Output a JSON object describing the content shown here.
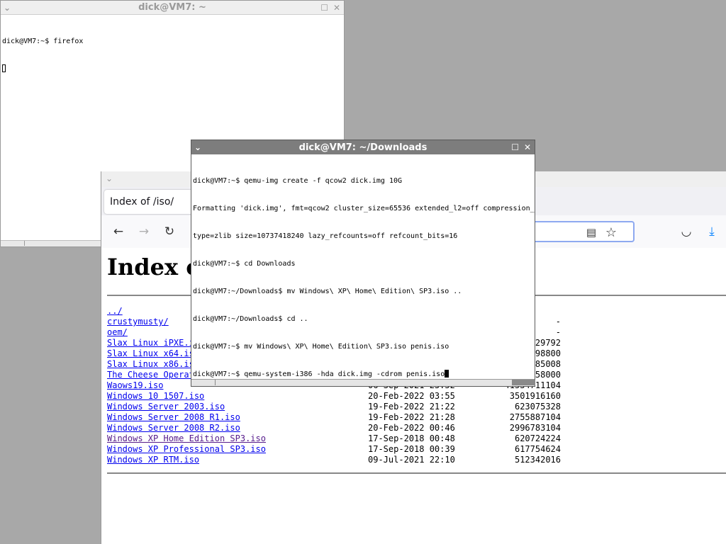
{
  "terminal1": {
    "title": "dick@VM7: ~",
    "lines": [
      "dick@VM7:~$ firefox"
    ]
  },
  "terminal2": {
    "title": "dick@VM7: ~/Downloads",
    "lines": [
      "dick@VM7:~$ qemu-img create -f qcow2 dick.img 10G",
      "Formatting 'dick.img', fmt=qcow2 cluster_size=65536 extended_l2=off compression_",
      "type=zlib size=10737418240 lazy_refcounts=off refcount_bits=16",
      "dick@VM7:~$ cd Downloads",
      "dick@VM7:~/Downloads$ mv Windows\\ XP\\ Home\\ Edition\\ SP3.iso ..",
      "dick@VM7:~/Downloads$ cd ..",
      "dick@VM7:~$ mv Windows\\ XP\\ Home\\ Edition\\ SP3.iso penis.iso",
      "dick@VM7:~$ qemu-system-i386 -hda dick.img -cdrom penis.iso"
    ]
  },
  "firefox": {
    "tab_title": "Index of /iso/",
    "heading": "Index of /iso/",
    "entries": [
      {
        "name": "../",
        "date": "",
        "size": "",
        "visited": false
      },
      {
        "name": "crustymusty/",
        "date": "",
        "size": "-",
        "visited": false
      },
      {
        "name": "oem/",
        "date": "",
        "size": "-",
        "visited": false
      },
      {
        "name": "Slax Linux iPXE.iso",
        "date": "",
        "size": "29792",
        "visited": false
      },
      {
        "name": "Slax Linux x64.iso",
        "date": "",
        "size": "98800",
        "visited": false
      },
      {
        "name": "Slax Linux x86.iso",
        "date": "",
        "size": "85008",
        "visited": false
      },
      {
        "name": "The Cheese Operating System.iso",
        "date": "",
        "size": "58000",
        "visited": false
      },
      {
        "name": "Waows19.iso",
        "date": "06-Sep-2021 23:52",
        "size": "41534711104",
        "visited": false
      },
      {
        "name": "Windows 10 1507.iso",
        "date": "20-Feb-2022 03:55",
        "size": "3501916160",
        "visited": false
      },
      {
        "name": "Windows Server 2003.iso",
        "date": "19-Feb-2022 21:22",
        "size": "623075328",
        "visited": false
      },
      {
        "name": "Windows Server 2008 R1.iso",
        "date": "19-Feb-2022 21:28",
        "size": "2755887104",
        "visited": false
      },
      {
        "name": "Windows Server 2008 R2.iso",
        "date": "20-Feb-2022 00:46",
        "size": "2996783104",
        "visited": false
      },
      {
        "name": "Windows XP Home Edition SP3.iso",
        "date": "17-Sep-2018 00:48",
        "size": "620724224",
        "visited": true
      },
      {
        "name": "Windows XP Professional SP3.iso",
        "date": "17-Sep-2018 00:39",
        "size": "617754624",
        "visited": false
      },
      {
        "name": "Windows XP RTM.iso",
        "date": "09-Jul-2021 22:10",
        "size": "512342016",
        "visited": false
      }
    ]
  },
  "icons": {
    "minimize": "⌄",
    "maximize": "☐",
    "close": "✕",
    "back": "←",
    "forward": "→",
    "reload": "↻",
    "reader": "▤",
    "bookmark": "☆",
    "pocket": "◡",
    "download": "⤓"
  },
  "colors": {
    "desktop": "#a8a8a8",
    "link": "#0000ee",
    "visited_link": "#551a8b",
    "active_titlebar": "#7d7d7d"
  }
}
